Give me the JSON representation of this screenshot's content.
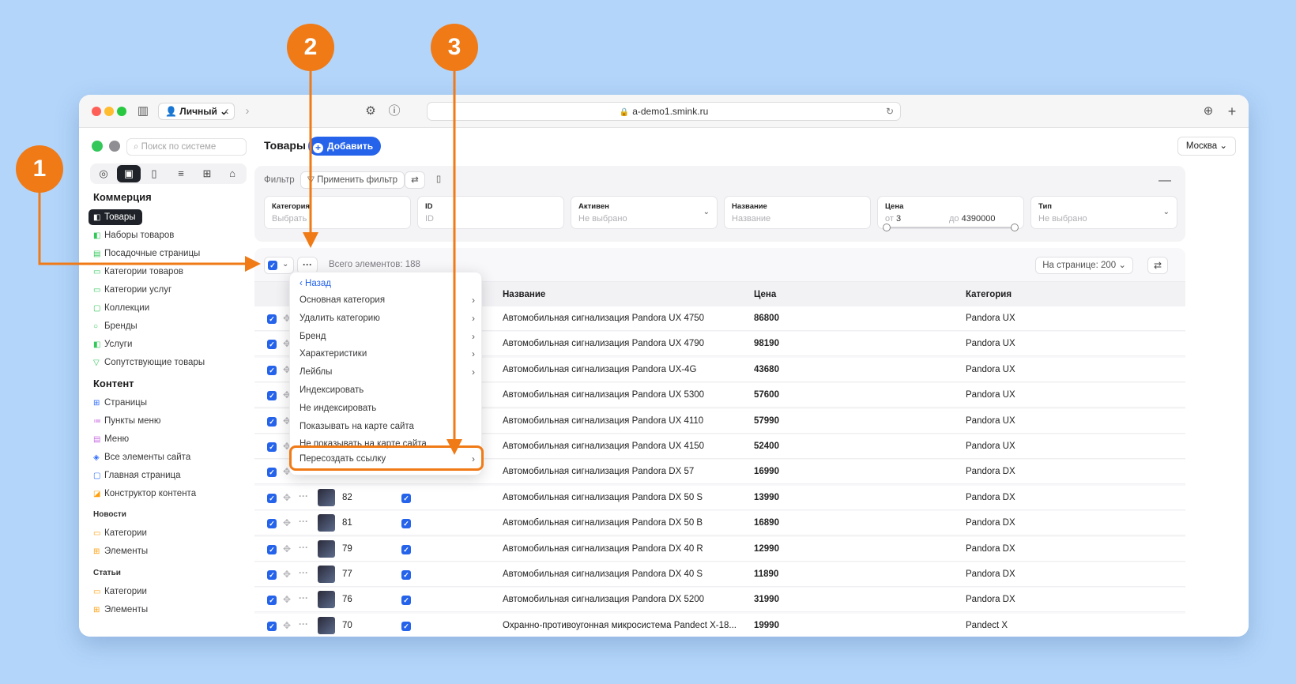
{
  "browser": {
    "profile": "Личный",
    "url": "a-demo1.smink.ru"
  },
  "sidebar": {
    "search_placeholder": "Поиск по системе",
    "section_commerce": "Коммерция",
    "commerce_items": [
      "Товары",
      "Наборы товаров",
      "Посадочные страницы",
      "Категории товаров",
      "Категории услуг",
      "Коллекции",
      "Бренды",
      "Услуги",
      "Сопутствующие товары"
    ],
    "section_content": "Контент",
    "content_items": [
      "Страницы",
      "Пункты меню",
      "Меню",
      "Все элементы сайта",
      "Главная страница",
      "Конструктор контента"
    ],
    "section_news": "Новости",
    "news_items": [
      "Категории",
      "Элементы"
    ],
    "section_articles": "Статьи",
    "articles_items": [
      "Категории",
      "Элементы"
    ]
  },
  "header": {
    "title": "Товары",
    "add_label": "Добавить",
    "city": "Москва"
  },
  "filter": {
    "label": "Фильтр",
    "apply_label": "Применить фильтр",
    "fields": [
      {
        "label": "Категория",
        "placeholder": "Выбрать"
      },
      {
        "label": "ID",
        "placeholder": "ID"
      },
      {
        "label": "Активен",
        "placeholder": "Не выбрано"
      },
      {
        "label": "Название",
        "placeholder": "Название"
      },
      {
        "label": "Цена",
        "from_label": "от",
        "from_value": "3",
        "to_label": "до",
        "to_value": "4390000"
      },
      {
        "label": "Тип",
        "placeholder": "Не выбрано"
      }
    ]
  },
  "table": {
    "total": "Всего элементов: 188",
    "per_page": "На странице: 200",
    "columns": [
      "Название",
      "Цена",
      "Категория"
    ],
    "rows": [
      {
        "id": "",
        "name": "Автомобильная сигнализация Pandora UX 4750",
        "price": "86800",
        "category": "Pandora UX"
      },
      {
        "id": "",
        "name": "Автомобильная сигнализация Pandora UX 4790",
        "price": "98190",
        "category": "Pandora UX"
      },
      {
        "id": "",
        "name": "Автомобильная сигнализация Pandora UX-4G",
        "price": "43680",
        "category": "Pandora UX"
      },
      {
        "id": "",
        "name": "Автомобильная сигнализация Pandora UX 5300",
        "price": "57600",
        "category": "Pandora UX"
      },
      {
        "id": "",
        "name": "Автомобильная сигнализация Pandora UX 4110",
        "price": "57990",
        "category": "Pandora UX"
      },
      {
        "id": "",
        "name": "Автомобильная сигнализация Pandora UX 4150",
        "price": "52400",
        "category": "Pandora UX"
      },
      {
        "id": "",
        "name": "Автомобильная сигнализация Pandora DX 57",
        "price": "16990",
        "category": "Pandora DX"
      },
      {
        "id": "82",
        "name": "Автомобильная сигнализация Pandora DX 50 S",
        "price": "13990",
        "category": "Pandora DX"
      },
      {
        "id": "81",
        "name": "Автомобильная сигнализация Pandora DX 50 B",
        "price": "16890",
        "category": "Pandora DX"
      },
      {
        "id": "79",
        "name": "Автомобильная сигнализация Pandora DX 40 R",
        "price": "12990",
        "category": "Pandora DX"
      },
      {
        "id": "77",
        "name": "Автомобильная сигнализация Pandora DX 40 S",
        "price": "11890",
        "category": "Pandora DX"
      },
      {
        "id": "76",
        "name": "Автомобильная сигнализация Pandora DX 5200",
        "price": "31990",
        "category": "Pandora DX"
      },
      {
        "id": "70",
        "name": "Охранно-противоугонная микросистема Pandect X-18...",
        "price": "19990",
        "category": "Pandect X"
      }
    ]
  },
  "menu": {
    "back_label": "Назад",
    "items": [
      {
        "label": "Основная категория",
        "submenu": true
      },
      {
        "label": "Удалить категорию",
        "submenu": true
      },
      {
        "label": "Бренд",
        "submenu": true
      },
      {
        "label": "Характеристики",
        "submenu": true
      },
      {
        "label": "Лейблы",
        "submenu": true
      },
      {
        "label": "Индексировать",
        "submenu": false
      },
      {
        "label": "Не индексировать",
        "submenu": false
      },
      {
        "label": "Показывать на карте сайта",
        "submenu": false
      },
      {
        "label": "Не показывать на карте сайта",
        "submenu": false
      },
      {
        "label": "Пересоздать ссылку",
        "submenu": true
      }
    ]
  },
  "annotations": [
    "1",
    "2",
    "3"
  ],
  "colors": {
    "accent": "#2563eb",
    "annotation": "#f07a16",
    "background": "#b3d5fa"
  }
}
